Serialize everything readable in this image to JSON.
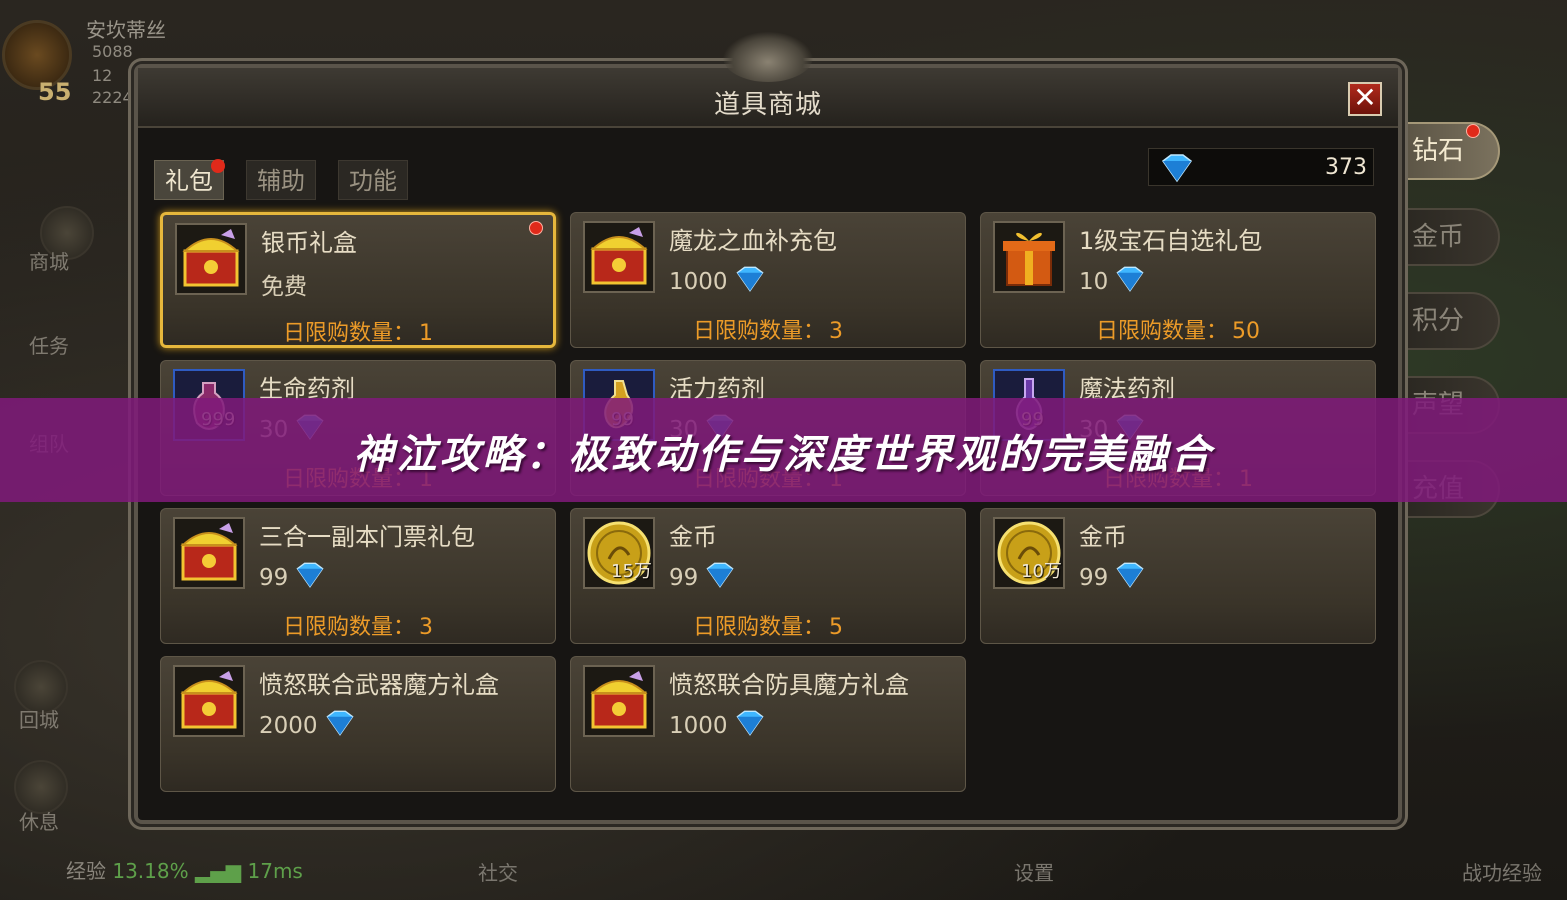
{
  "hud": {
    "player_name": "安坎蒂丝",
    "level": "55",
    "stat_1": "5088",
    "stat_2": "12",
    "stat_3": "2224",
    "left_menu": [
      "商城",
      "任务",
      "组队",
      "回城",
      "休息"
    ],
    "exp_label": "经验",
    "exp_value": "13.18%",
    "ping": "17ms",
    "bottom_social": "社交",
    "bottom_settings": "设置",
    "bottom_right": "战功经验"
  },
  "shop": {
    "title": "道具商城",
    "close_label": "✕",
    "category_tabs": [
      {
        "label": "礼包",
        "active": true,
        "dot": true
      },
      {
        "label": "辅助",
        "active": false,
        "dot": false
      },
      {
        "label": "功能",
        "active": false,
        "dot": false
      }
    ],
    "diamond_balance": "373",
    "limit_label": "日限购数量：",
    "items": [
      {
        "name": "银币礼盒",
        "price": "免费",
        "currency": "",
        "limit": "1",
        "icon": "treasure-chest",
        "selected": true,
        "dot": true
      },
      {
        "name": "魔龙之血补充包",
        "price": "1000",
        "currency": "diamond",
        "limit": "3",
        "icon": "treasure-chest"
      },
      {
        "name": "1级宝石自选礼包",
        "price": "10",
        "currency": "diamond",
        "limit": "50",
        "icon": "gift-box"
      },
      {
        "name": "生命药剂",
        "price": "30",
        "currency": "diamond",
        "limit": "1",
        "icon": "health-potion",
        "badge": "999"
      },
      {
        "name": "活力药剂",
        "price": "30",
        "currency": "diamond",
        "limit": "1",
        "icon": "vitality-potion",
        "badge": "99"
      },
      {
        "name": "魔法药剂",
        "price": "30",
        "currency": "diamond",
        "limit": "1",
        "icon": "mana-potion",
        "badge": "99"
      },
      {
        "name": "三合一副本门票礼包",
        "price": "99",
        "currency": "diamond",
        "limit": "3",
        "icon": "treasure-chest"
      },
      {
        "name": "金币",
        "price": "99",
        "currency": "diamond",
        "limit": "5",
        "icon": "gold-coin",
        "badge": "15万"
      },
      {
        "name": "金币",
        "price": "99",
        "currency": "diamond",
        "limit": "",
        "icon": "gold-coin",
        "badge": "10万"
      },
      {
        "name": "愤怒联合武器魔方礼盒",
        "price": "2000",
        "currency": "diamond",
        "limit": "",
        "icon": "treasure-chest"
      },
      {
        "name": "愤怒联合防具魔方礼盒",
        "price": "1000",
        "currency": "diamond",
        "limit": "",
        "icon": "treasure-chest"
      }
    ]
  },
  "side_tabs": [
    {
      "label": "钻石",
      "active": true,
      "dot": true
    },
    {
      "label": "金币",
      "active": false
    },
    {
      "label": "积分",
      "active": false
    },
    {
      "label": "声望",
      "active": false
    },
    {
      "label": "充值",
      "active": false
    }
  ],
  "banner": {
    "text": "神泣攻略：极致动作与深度世界观的完美融合"
  },
  "colors": {
    "limit_text": "#ec9b28",
    "selected_border": "#e6b73c",
    "banner_bg": "#801a7a",
    "notification_dot": "#e02a1a"
  }
}
